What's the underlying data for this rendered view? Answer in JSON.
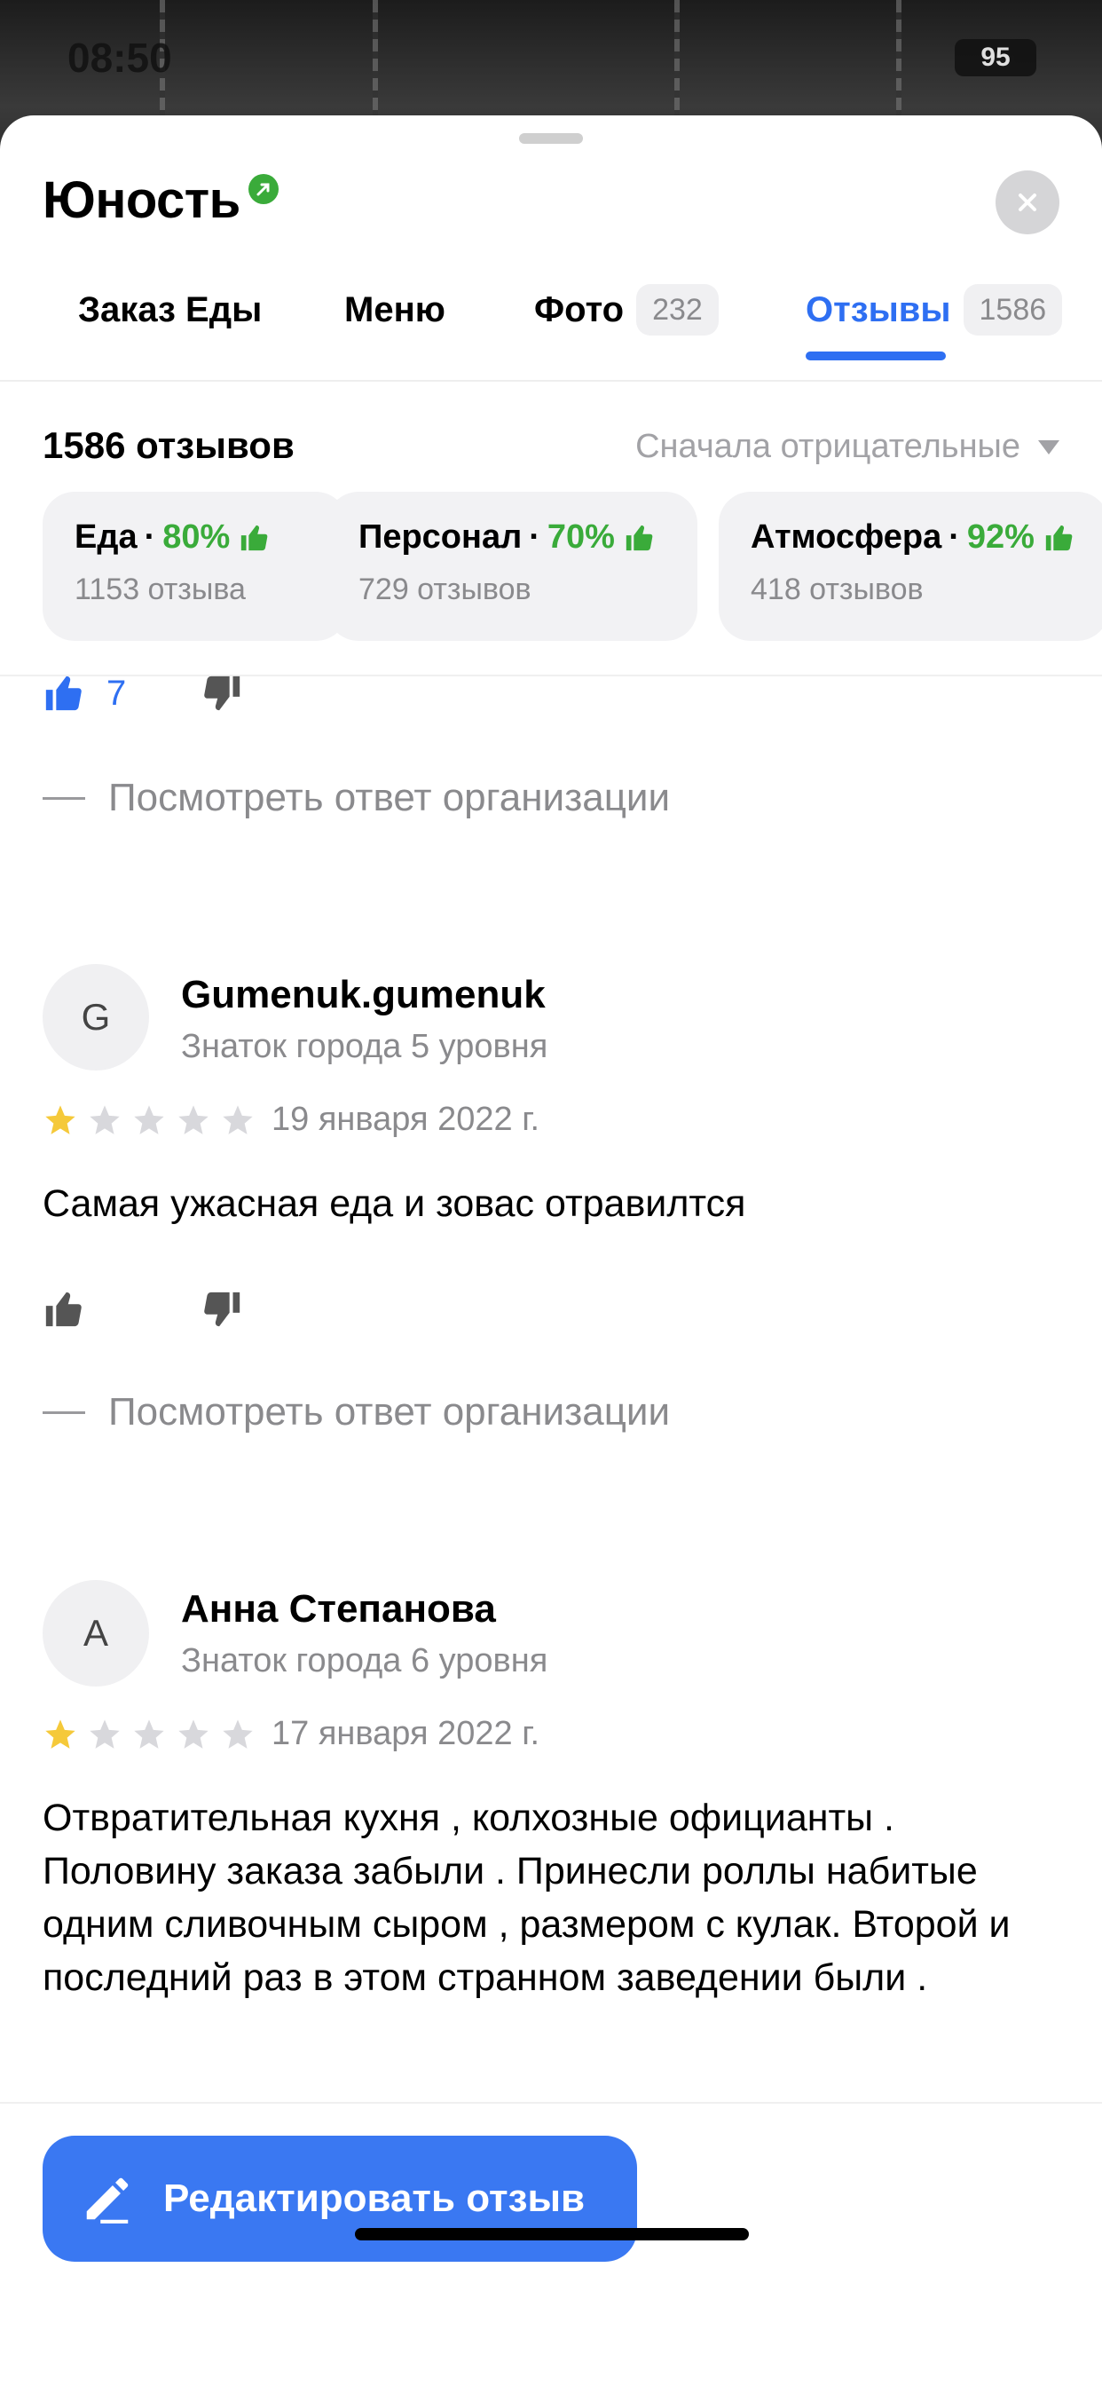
{
  "status_bar": {
    "time": "08:50",
    "battery": "95"
  },
  "header": {
    "title": "Юность",
    "verified_icon": "verified-arrow-icon",
    "close_icon": "close-icon"
  },
  "tabs": [
    {
      "label": "Заказ Еды"
    },
    {
      "label": "Меню"
    },
    {
      "label": "Фото",
      "count": "232"
    },
    {
      "label": "Отзывы",
      "count": "1586",
      "active": true
    }
  ],
  "reviews_header": {
    "count_label": "1586 отзывов",
    "sort_label": "Сначала отрицательные"
  },
  "aspects": [
    {
      "name": "Еда",
      "percent": "80%",
      "reviews": "1153 отзыва"
    },
    {
      "name": "Персонал",
      "percent": "70%",
      "reviews": "729 отзывов"
    },
    {
      "name": "Атмосфера",
      "percent": "92%",
      "reviews": "418 отзывов"
    }
  ],
  "prev_review": {
    "likes": "7",
    "see_reply": "Посмотреть ответ организации"
  },
  "reviews": [
    {
      "avatar_letter": "G",
      "author": "Gumenuk.gumenuk",
      "level": "Знаток города 5 уровня",
      "rating": 1,
      "date": "19 января 2022 г.",
      "text": "Самая ужасная еда  и зовас отравилтся",
      "see_reply": "Посмотреть ответ организации"
    },
    {
      "avatar_letter": "А",
      "author": "Анна Степанова",
      "level": "Знаток города 6 уровня",
      "rating": 1,
      "date": "17 января 2022 г.",
      "text": "Отвратительная кухня , колхозные официанты . Половину заказа забыли . Принесли роллы набитые одним сливочным сыром , размером с кулак. Второй и последний раз в этом странном заведении были ."
    }
  ],
  "edit_button": {
    "label": "Редактировать отзыв",
    "icon": "pencil-icon"
  },
  "colors": {
    "accent": "#2e6ff2",
    "positive": "#3aab3a",
    "star_active": "#f5c93a",
    "star_inactive": "#d8d8dc"
  }
}
